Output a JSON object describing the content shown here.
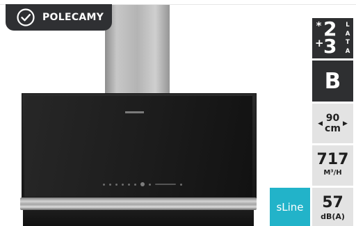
{
  "badge": {
    "label": "POLECAMY",
    "icon": "check-circle-icon"
  },
  "product": {
    "type": "chimney cooker hood image"
  },
  "specs": {
    "warranty": {
      "line1_symbol": "*",
      "line1_number": "2",
      "line2_symbol": "+",
      "line2_number": "3",
      "vertical_text": [
        "L",
        "A",
        "T",
        "A"
      ]
    },
    "energy_class": "B",
    "width": {
      "value": "90",
      "unit": "cm",
      "left_icon": "caret-left-icon",
      "right_icon": "caret-right-icon"
    },
    "airflow": {
      "value": "717",
      "unit": "M³/H"
    },
    "noise": {
      "value": "57",
      "unit": "dB(A)"
    },
    "series": "sLine"
  },
  "colors": {
    "badge_bg": "#2f3033",
    "tile_bg": "#e3e3e3",
    "dark_tile_bg": "#2e2f31",
    "series_bg": "#22b3c9"
  }
}
